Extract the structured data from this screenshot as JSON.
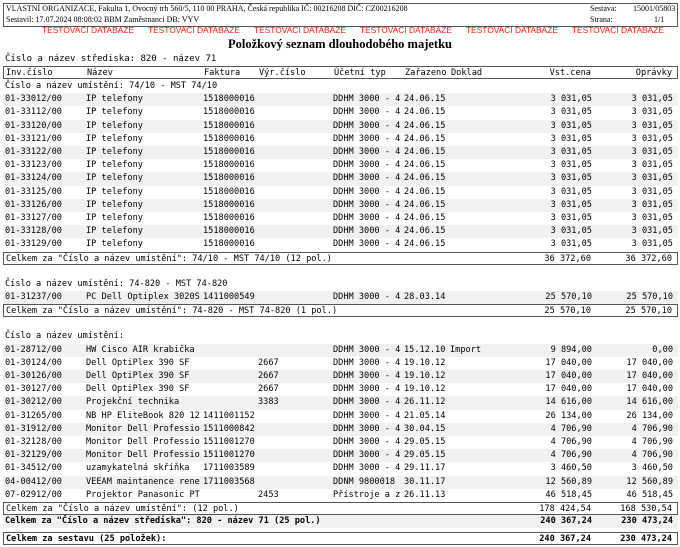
{
  "header": {
    "org": "VLASTNÍ ORGANIZACE, Fakulta 1, Ovocný trh 560/5, 110 00 PRAHA, Česká republika  IČ: 00216208  DIČ: CZ00216208",
    "created": "Sestavil: 17.07.2024 08:08:02 BBM Zaměstnanci  DB: VYV",
    "sestava_label": "Sestava:",
    "sestava_value": "15001/05803",
    "strana_label": "Strana:",
    "strana_value": "1/1"
  },
  "watermark": [
    "TESTOVACÍ DATABÁZE",
    "TESTOVACÍ DATABÁZE",
    "TESTOVACÍ DATABÁZE",
    "TESTOVACÍ DATABÁZE",
    "TESTOVACÍ DATABÁZE",
    "TESTOVACÍ DATABÁZE"
  ],
  "title": "Položkový seznam dlouhodobého majetku",
  "center": "Číslo a název střediska: 820 - název 71",
  "columns": [
    "Inv.číslo",
    "Název",
    "Faktura",
    "Výr.číslo",
    "Účetní typ",
    "Zařazeno",
    "Doklad",
    "Vst.cena",
    "Oprávky"
  ],
  "groups": [
    {
      "label": "Číslo a název umístění: 74/10 - MST 74/10",
      "rows": [
        [
          "01-33012/00",
          "IP telefony",
          "1518000016",
          "",
          "DDHM 3000 - 4",
          "24.06.15",
          "",
          "3 031,05",
          "3 031,05"
        ],
        [
          "01-33112/00",
          "IP telefony",
          "1518000016",
          "",
          "DDHM 3000 - 4",
          "24.06.15",
          "",
          "3 031,05",
          "3 031,05"
        ],
        [
          "01-33120/00",
          "IP telefony",
          "1518000016",
          "",
          "DDHM 3000 - 4",
          "24.06.15",
          "",
          "3 031,05",
          "3 031,05"
        ],
        [
          "01-33121/00",
          "IP telefony",
          "1518000016",
          "",
          "DDHM 3000 - 4",
          "24.06.15",
          "",
          "3 031,05",
          "3 031,05"
        ],
        [
          "01-33122/00",
          "IP telefony",
          "1518000016",
          "",
          "DDHM 3000 - 4",
          "24.06.15",
          "",
          "3 031,05",
          "3 031,05"
        ],
        [
          "01-33123/00",
          "IP telefony",
          "1518000016",
          "",
          "DDHM 3000 - 4",
          "24.06.15",
          "",
          "3 031,05",
          "3 031,05"
        ],
        [
          "01-33124/00",
          "IP telefony",
          "1518000016",
          "",
          "DDHM 3000 - 4",
          "24.06.15",
          "",
          "3 031,05",
          "3 031,05"
        ],
        [
          "01-33125/00",
          "IP telefony",
          "1518000016",
          "",
          "DDHM 3000 - 4",
          "24.06.15",
          "",
          "3 031,05",
          "3 031,05"
        ],
        [
          "01-33126/00",
          "IP telefony",
          "1518000016",
          "",
          "DDHM 3000 - 4",
          "24.06.15",
          "",
          "3 031,05",
          "3 031,05"
        ],
        [
          "01-33127/00",
          "IP telefony",
          "1518000016",
          "",
          "DDHM 3000 - 4",
          "24.06.15",
          "",
          "3 031,05",
          "3 031,05"
        ],
        [
          "01-33128/00",
          "IP telefony",
          "1518000016",
          "",
          "DDHM 3000 - 4",
          "24.06.15",
          "",
          "3 031,05",
          "3 031,05"
        ],
        [
          "01-33129/00",
          "IP telefony",
          "1518000016",
          "",
          "DDHM 3000 - 4",
          "24.06.15",
          "",
          "3 031,05",
          "3 031,05"
        ]
      ],
      "total": {
        "label": "Celkem za \"Číslo a název umístění\": 74/10 - MST 74/10 (12 pol.)",
        "vst": "36 372,60",
        "opr": "36 372,60"
      }
    },
    {
      "label": "Číslo a název umístění: 74-820 - MST 74-820",
      "rows": [
        [
          "01-31237/00",
          "PC Dell Optiplex 3020S",
          "1411000549",
          "",
          "DDHM 3000 - 4",
          "28.03.14",
          "",
          "25 570,10",
          "25 570,10"
        ]
      ],
      "total": {
        "label": "Celkem za \"Číslo a název umístění\": 74-820 - MST 74-820 (1 pol.)",
        "vst": "25 570,10",
        "opr": "25 570,10"
      }
    },
    {
      "label": "Číslo a název umístění:",
      "rows": [
        [
          "01-28712/00",
          "HW Cisco AIR krabička",
          "",
          "",
          "DDHM 3000 - 4",
          "15.12.10",
          "Import",
          "9 894,00",
          "0,00"
        ],
        [
          "01-30124/00",
          "Dell OptiPlex 390 SF",
          "",
          "2667",
          "DDHM 3000 - 4",
          "19.10.12",
          "",
          "17 040,00",
          "17 040,00"
        ],
        [
          "01-30126/00",
          "Dell OptiPlex 390 SF",
          "",
          "2667",
          "DDHM 3000 - 4",
          "19.10.12",
          "",
          "17 040,00",
          "17 040,00"
        ],
        [
          "01-30127/00",
          "Dell OptiPlex 390 SF",
          "",
          "2667",
          "DDHM 3000 - 4",
          "19.10.12",
          "",
          "17 040,00",
          "17 040,00"
        ],
        [
          "01-30212/00",
          "Projekční technika",
          "",
          "3383",
          "DDHM 3000 - 4",
          "26.11.12",
          "",
          "14 616,00",
          "14 616,00"
        ],
        [
          "01-31265/00",
          "NB HP EliteBook 820 12",
          "1411001152",
          "",
          "DDHM 3000 - 4",
          "21.05.14",
          "",
          "26 134,00",
          "26 134,00"
        ],
        [
          "01-31912/00",
          "Monitor Dell Professio",
          "1511000842",
          "",
          "DDHM 3000 - 4",
          "30.04.15",
          "",
          "4 706,90",
          "4 706,90"
        ],
        [
          "01-32128/00",
          "Monitor Dell Professio",
          "1511001270",
          "",
          "DDHM 3000 - 4",
          "29.05.15",
          "",
          "4 706,90",
          "4 706,90"
        ],
        [
          "01-32129/00",
          "Monitor Dell Professio",
          "1511001270",
          "",
          "DDHM 3000 - 4",
          "29.05.15",
          "",
          "4 706,90",
          "4 706,90"
        ],
        [
          "01-34512/00",
          "uzamykatelná skříňka",
          "1711003589",
          "",
          "DDHM 3000 - 4",
          "29.11.17",
          "",
          "3 460,50",
          "3 460,50"
        ],
        [
          "04-00412/00",
          "VEEAM maintanence rene",
          "1711003568",
          "",
          "DDNM 9800018",
          "30.11.17",
          "",
          "12 560,89",
          "12 560,89"
        ],
        [
          "07-02912/00",
          "Projektor Panasonic PT",
          "",
          "2453",
          "Přístroje a z",
          "26.11.13",
          "",
          "46 518,45",
          "46 518,45"
        ]
      ],
      "total": {
        "label": "Celkem za \"Číslo a název umístění\":  (12 pol.)",
        "vst": "178 424,54",
        "opr": "168 530,54"
      }
    }
  ],
  "center_total": {
    "label": "Celkem za \"Číslo a název střediska\": 820 - název 71 (25 pol.)",
    "vst": "240 367,24",
    "opr": "230 473,24"
  },
  "grand_total": {
    "label": "Celkem za sestavu (25 položek):",
    "vst": "240 367,24",
    "opr": "230 473,24"
  }
}
